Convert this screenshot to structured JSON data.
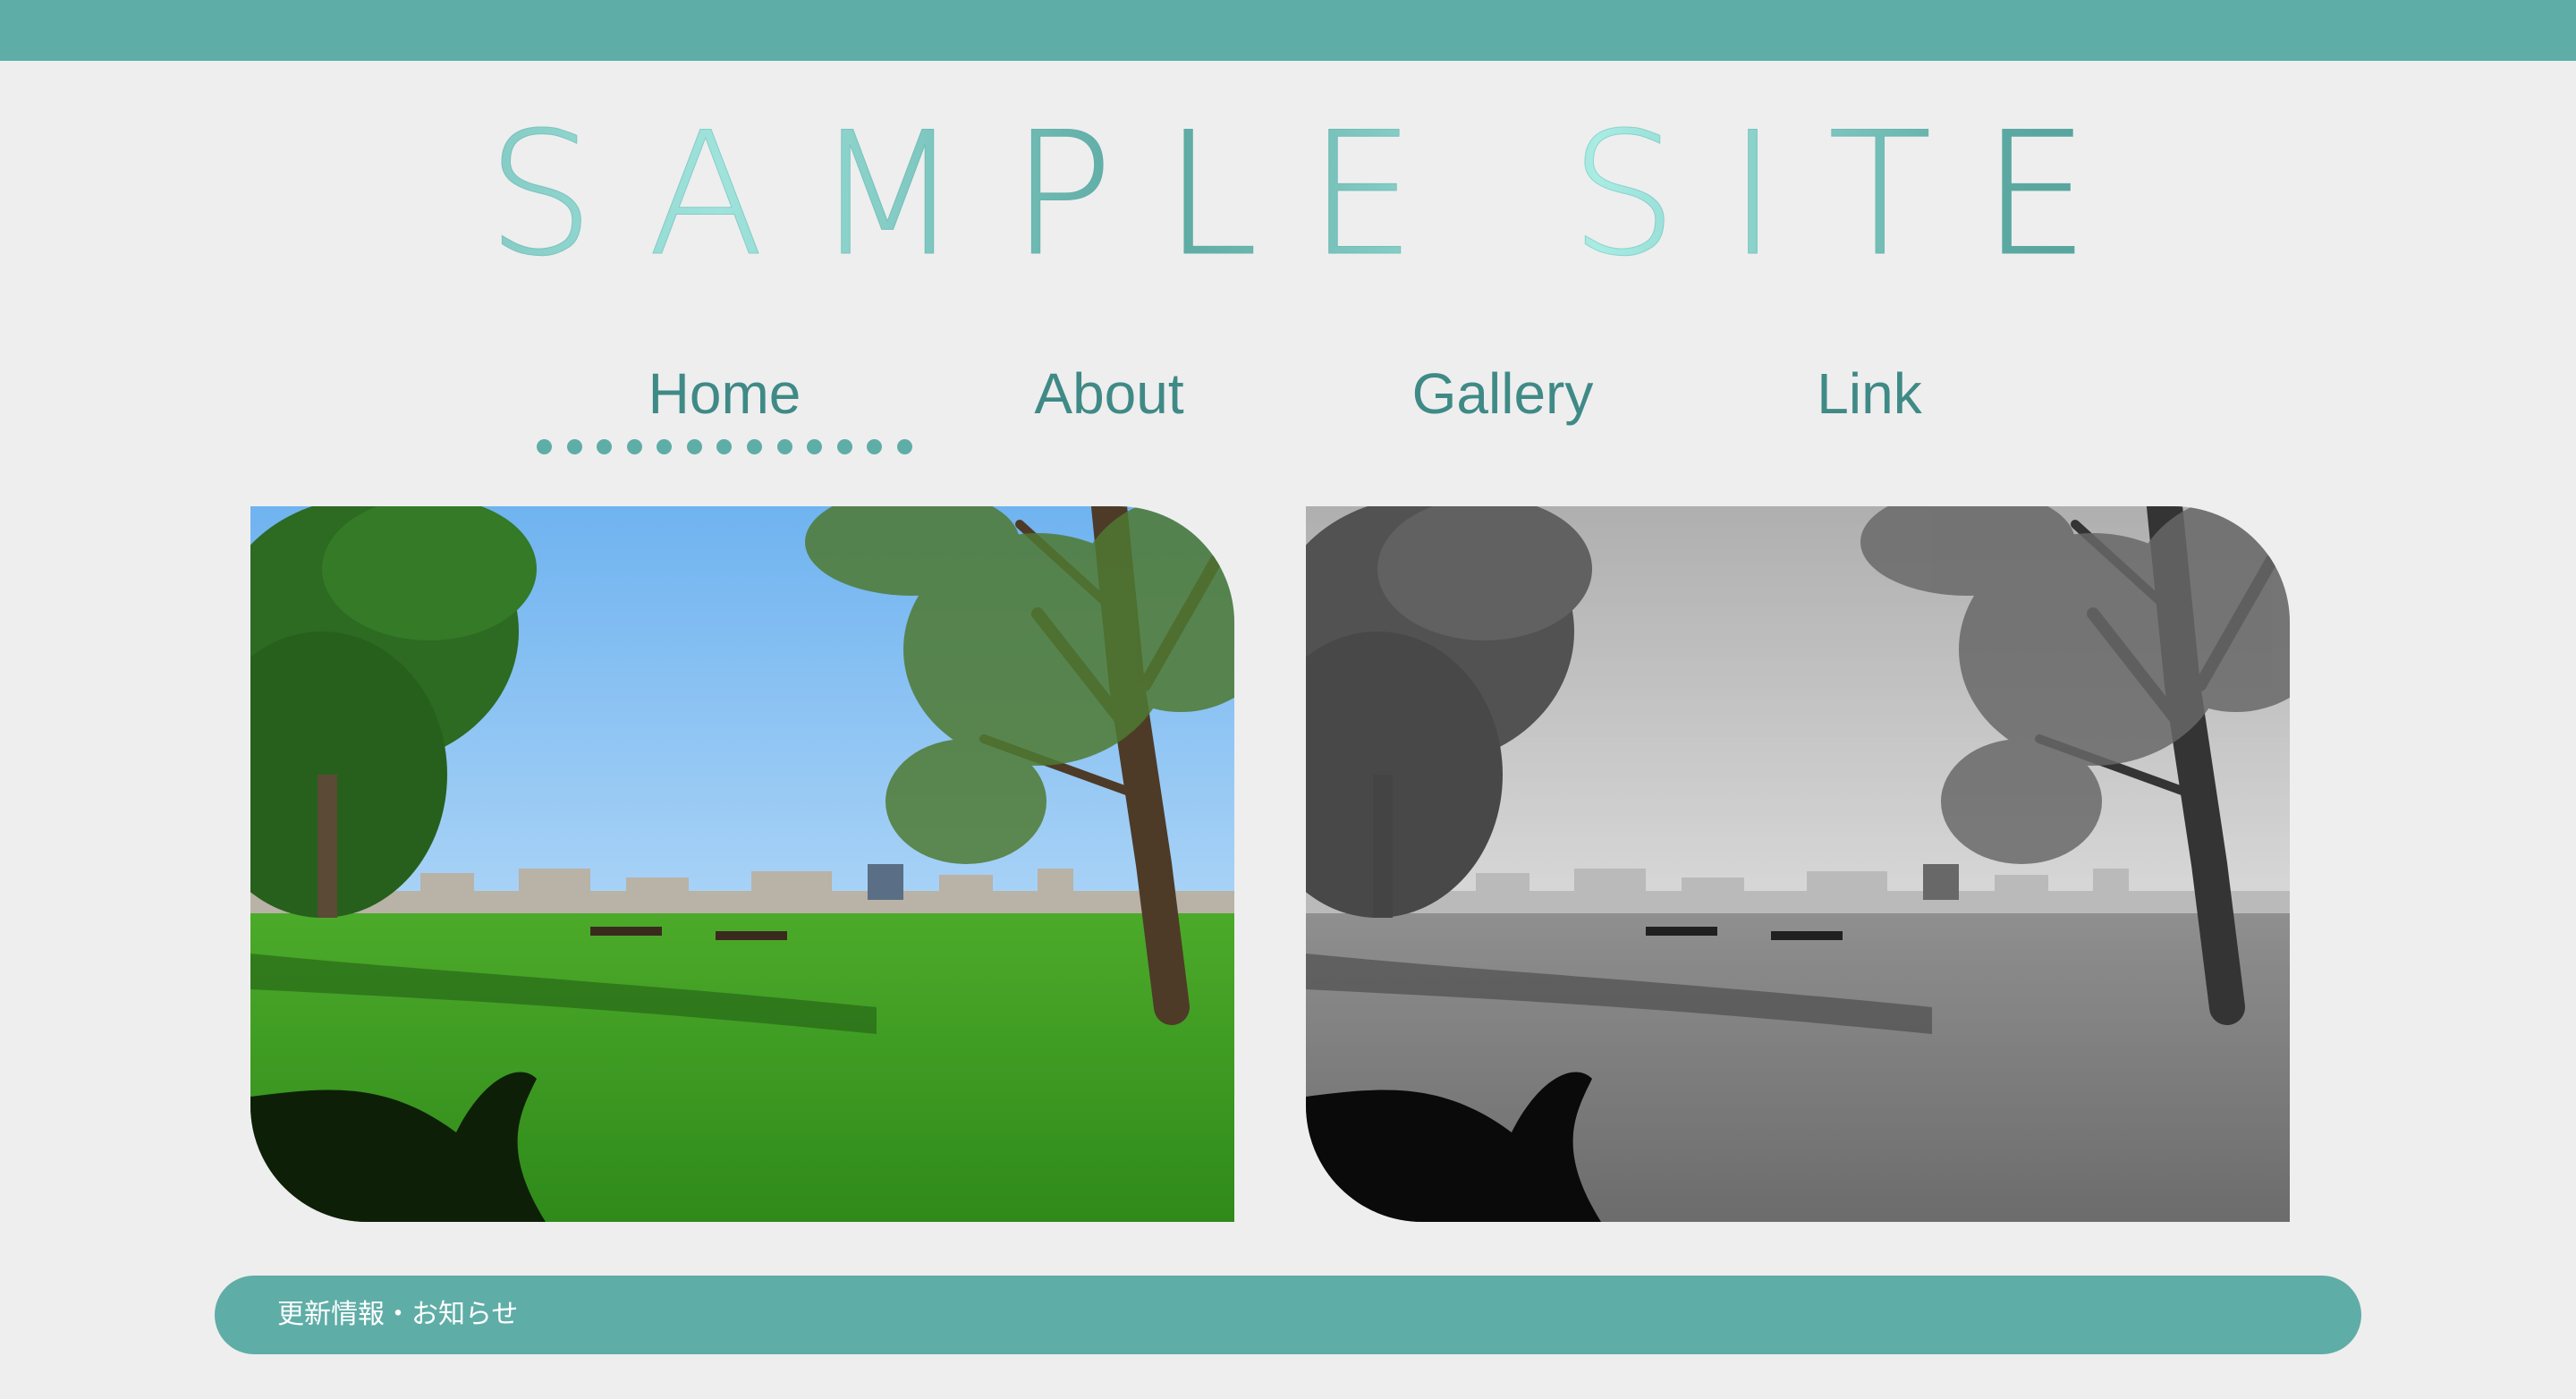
{
  "header": {
    "title": "SAMPLE SITE",
    "bar_color": "#5fada7"
  },
  "nav": {
    "items": [
      {
        "label": "Home",
        "active": true
      },
      {
        "label": "About",
        "active": false
      },
      {
        "label": "Gallery",
        "active": false
      },
      {
        "label": "Link",
        "active": false
      }
    ],
    "text_color": "#3f8a86",
    "underline_color": "#5fada7"
  },
  "gallery": {
    "images": [
      {
        "name": "park-photo-color",
        "style": "color"
      },
      {
        "name": "park-photo-monochrome",
        "style": "monochrome"
      }
    ]
  },
  "news": {
    "label": "更新情報・お知らせ"
  }
}
